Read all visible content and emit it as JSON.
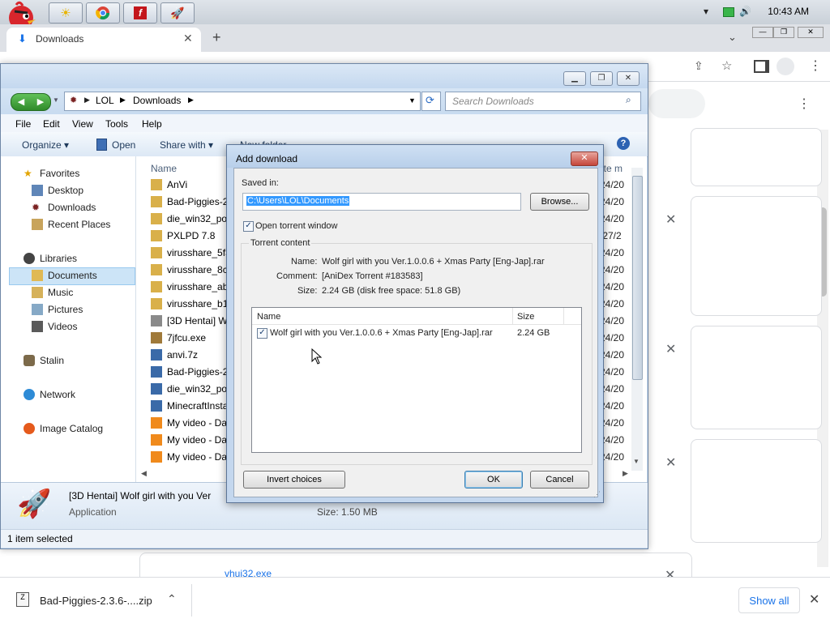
{
  "taskbar": {
    "time": "10:43 AM",
    "icons": [
      "angry-bird-icon",
      "sun-icon",
      "chrome-icon",
      "flash-icon",
      "rocket-icon"
    ]
  },
  "chrome": {
    "tab_title": "Downloads",
    "new_tab_label": "+",
    "card_item": "vhui32.exe",
    "shelf": {
      "file_label": "Bad-Piggies-2.3.6-....zip",
      "show_all": "Show all"
    }
  },
  "explorer": {
    "breadcrumb": [
      "LOL",
      "Downloads"
    ],
    "search_placeholder": "Search Downloads",
    "menu": [
      "File",
      "Edit",
      "View",
      "Tools",
      "Help"
    ],
    "commands": {
      "organize": "Organize",
      "open": "Open",
      "share_with": "Share with",
      "new_folder": "New folder"
    },
    "nav": {
      "favorites": "Favorites",
      "desktop": "Desktop",
      "downloads": "Downloads",
      "recent": "Recent Places",
      "libraries": "Libraries",
      "documents": "Documents",
      "music": "Music",
      "pictures": "Pictures",
      "videos": "Videos",
      "stalin": "Stalin",
      "network": "Network",
      "image_catalog": "Image Catalog"
    },
    "columns": {
      "name": "Name",
      "date": "ate m"
    },
    "files": [
      {
        "name": "AnVi",
        "date": "24/20"
      },
      {
        "name": "Bad-Piggies-2",
        "date": "24/20"
      },
      {
        "name": "die_win32_por",
        "date": "24/20"
      },
      {
        "name": "PXLPD 7.8",
        "date": "/27/2"
      },
      {
        "name": "virusshare_5f3",
        "date": "24/20"
      },
      {
        "name": "virusshare_8c7",
        "date": "24/20"
      },
      {
        "name": "virusshare_abl",
        "date": "24/20"
      },
      {
        "name": "virusshare_b17",
        "date": "24/20"
      },
      {
        "name": "[3D Hentai] W",
        "date": "24/20"
      },
      {
        "name": "7jfcu.exe",
        "date": "24/20"
      },
      {
        "name": "anvi.7z",
        "date": "24/20"
      },
      {
        "name": "Bad-Piggies-2",
        "date": "24/20"
      },
      {
        "name": "die_win32_por",
        "date": "24/20"
      },
      {
        "name": "MinecraftInsta",
        "date": "24/20"
      },
      {
        "name": "My video - Da",
        "date": "24/20"
      },
      {
        "name": "My video - Da",
        "date": "24/20"
      },
      {
        "name": "My video - Da",
        "date": "24/20"
      }
    ],
    "details": {
      "name": "[3D Hentai] Wolf girl with you Ver",
      "type": "Application",
      "size": "Size: 1.50 MB"
    },
    "status": "1 item selected"
  },
  "dialog": {
    "title": "Add download",
    "saved_in_label": "Saved in:",
    "saved_in_value": "C:\\Users\\LOL\\Documents",
    "browse": "Browse...",
    "open_torrent_window": "Open torrent window",
    "torrent_content": "Torrent content",
    "name_label": "Name:",
    "name_value": "Wolf girl with you Ver.1.0.0.6 + Xmas Party [Eng-Jap].rar",
    "comment_label": "Comment:",
    "comment_value": "[AniDex Torrent #183583]",
    "size_label": "Size:",
    "size_value": "2.24 GB (disk free space: 51.8 GB)",
    "list_headers": {
      "name": "Name",
      "size": "Size"
    },
    "list_rows": [
      {
        "name": "Wolf girl with you Ver.1.0.0.6 + Xmas Party [Eng-Jap].rar",
        "size": "2.24 GB",
        "checked": true
      }
    ],
    "invert": "Invert choices",
    "ok": "OK",
    "cancel": "Cancel"
  }
}
